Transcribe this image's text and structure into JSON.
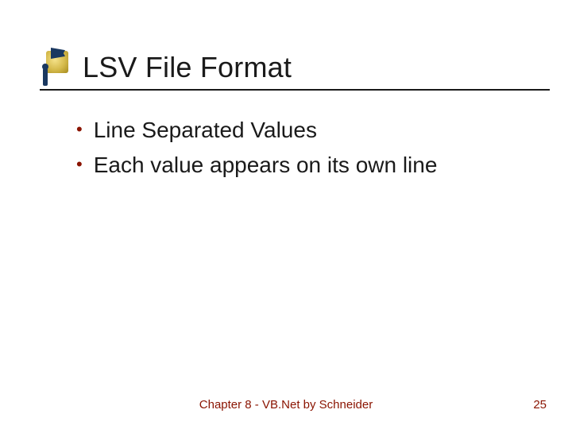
{
  "slide": {
    "title": "LSV File Format",
    "bullets": [
      "Line Separated Values",
      "Each value appears on its own line"
    ],
    "footer_center": "Chapter 8 - VB.Net by Schneider",
    "page_number": "25"
  },
  "colors": {
    "accent": "#8a1300",
    "text": "#1a1a1a",
    "logo_gold": "#d4b94a",
    "logo_navy": "#1a3860"
  }
}
